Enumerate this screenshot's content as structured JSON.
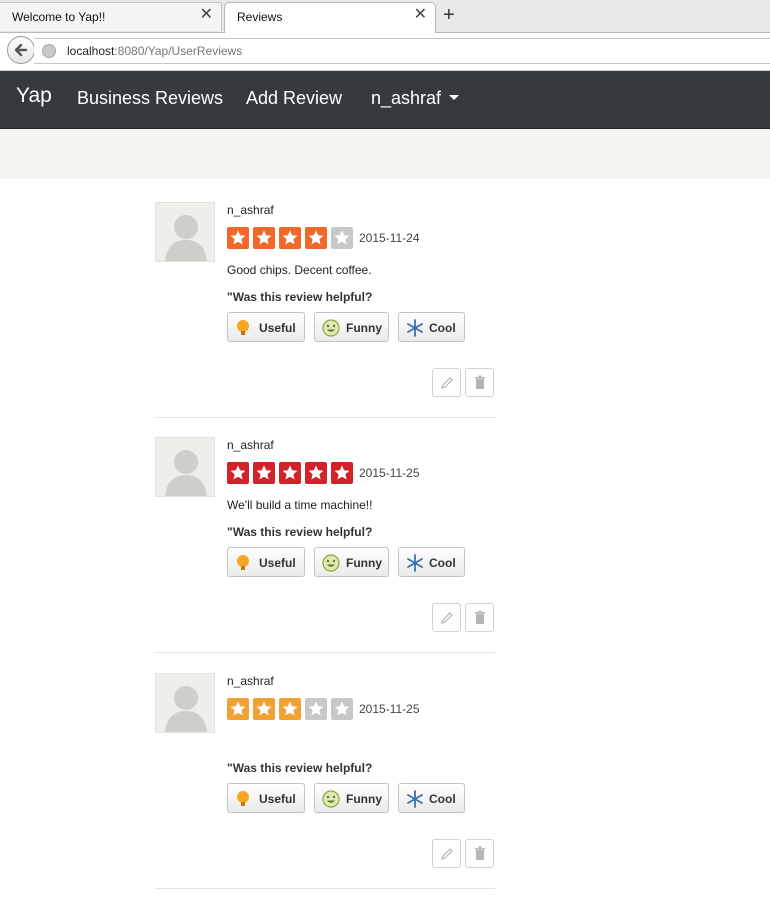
{
  "browser": {
    "tabs": [
      {
        "title": "Welcome to Yap!!"
      },
      {
        "title": "Reviews"
      }
    ],
    "url_host": "localhost",
    "url_path": ":8080/Yap/UserReviews"
  },
  "nav": {
    "brand": "Yap",
    "links": [
      "Business Reviews",
      "Add Review"
    ],
    "user": "n_ashraf"
  },
  "colors": {
    "navbar": "#343a3d",
    "star_orange": "#f1682a",
    "star_red": "#d2232a",
    "star_amber": "#f0a232",
    "star_empty": "#c8c8c8"
  },
  "helpful_prompt": "\"Was this review helpful?",
  "vote_labels": {
    "useful": "Useful",
    "funny": "Funny",
    "cool": "Cool"
  },
  "reviews": [
    {
      "author": "n_ashraf",
      "rating": 4,
      "max": 5,
      "date": "2015-11-24",
      "text": "Good chips. Decent coffee.",
      "star_color": "#f1682a"
    },
    {
      "author": "n_ashraf",
      "rating": 5,
      "max": 5,
      "date": "2015-11-25",
      "text": "We'll build a time machine!!",
      "star_color": "#d2232a"
    },
    {
      "author": "n_ashraf",
      "rating": 3,
      "max": 5,
      "date": "2015-11-25",
      "text": "",
      "star_color": "#f0a232"
    }
  ]
}
